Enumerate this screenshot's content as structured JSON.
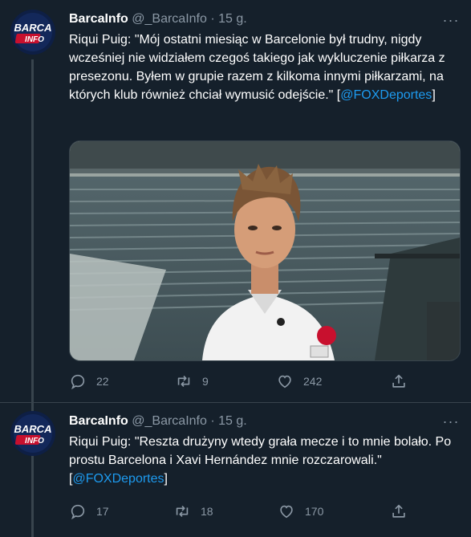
{
  "tweets": [
    {
      "author_name": "BarcaInfo",
      "author_handle": "@_BarcaInfo",
      "separator": "·",
      "time": "15 g.",
      "avatar_text": [
        "BARCA",
        "INFO"
      ],
      "text": "Riqui Puig: \"Mój ostatni miesiąc w Barcelonie był trudny, nigdy wcześniej nie widziałem czegoś takiego jak wykluczenie piłkarza z presezonu. Byłem w grupie razem z kilkoma innymi piłkarzami, na których klub również chciał wymusić odejście.\" [",
      "link": "@FOXDeportes",
      "text_end": "]",
      "replies": "22",
      "retweets": "9",
      "likes": "242"
    },
    {
      "author_name": "BarcaInfo",
      "author_handle": "@_BarcaInfo",
      "separator": "·",
      "time": "15 g.",
      "avatar_text": [
        "BARCA",
        "INFO"
      ],
      "text": "Riqui Puig: \"Reszta drużyny wtedy grała mecze i to mnie bolało. Po prostu Barcelona i Xavi Hernández mnie rozczarowali.\" [",
      "link": "@FOXDeportes",
      "text_end": "]",
      "replies": "17",
      "retweets": "18",
      "likes": "170"
    }
  ],
  "more_glyph": "···",
  "colors": {
    "background": "#15202b",
    "link": "#1d9bf0",
    "muted": "#8b98a5",
    "border": "#38444d"
  },
  "icons": [
    "reply-icon",
    "retweet-icon",
    "like-icon",
    "share-icon",
    "more-icon"
  ]
}
